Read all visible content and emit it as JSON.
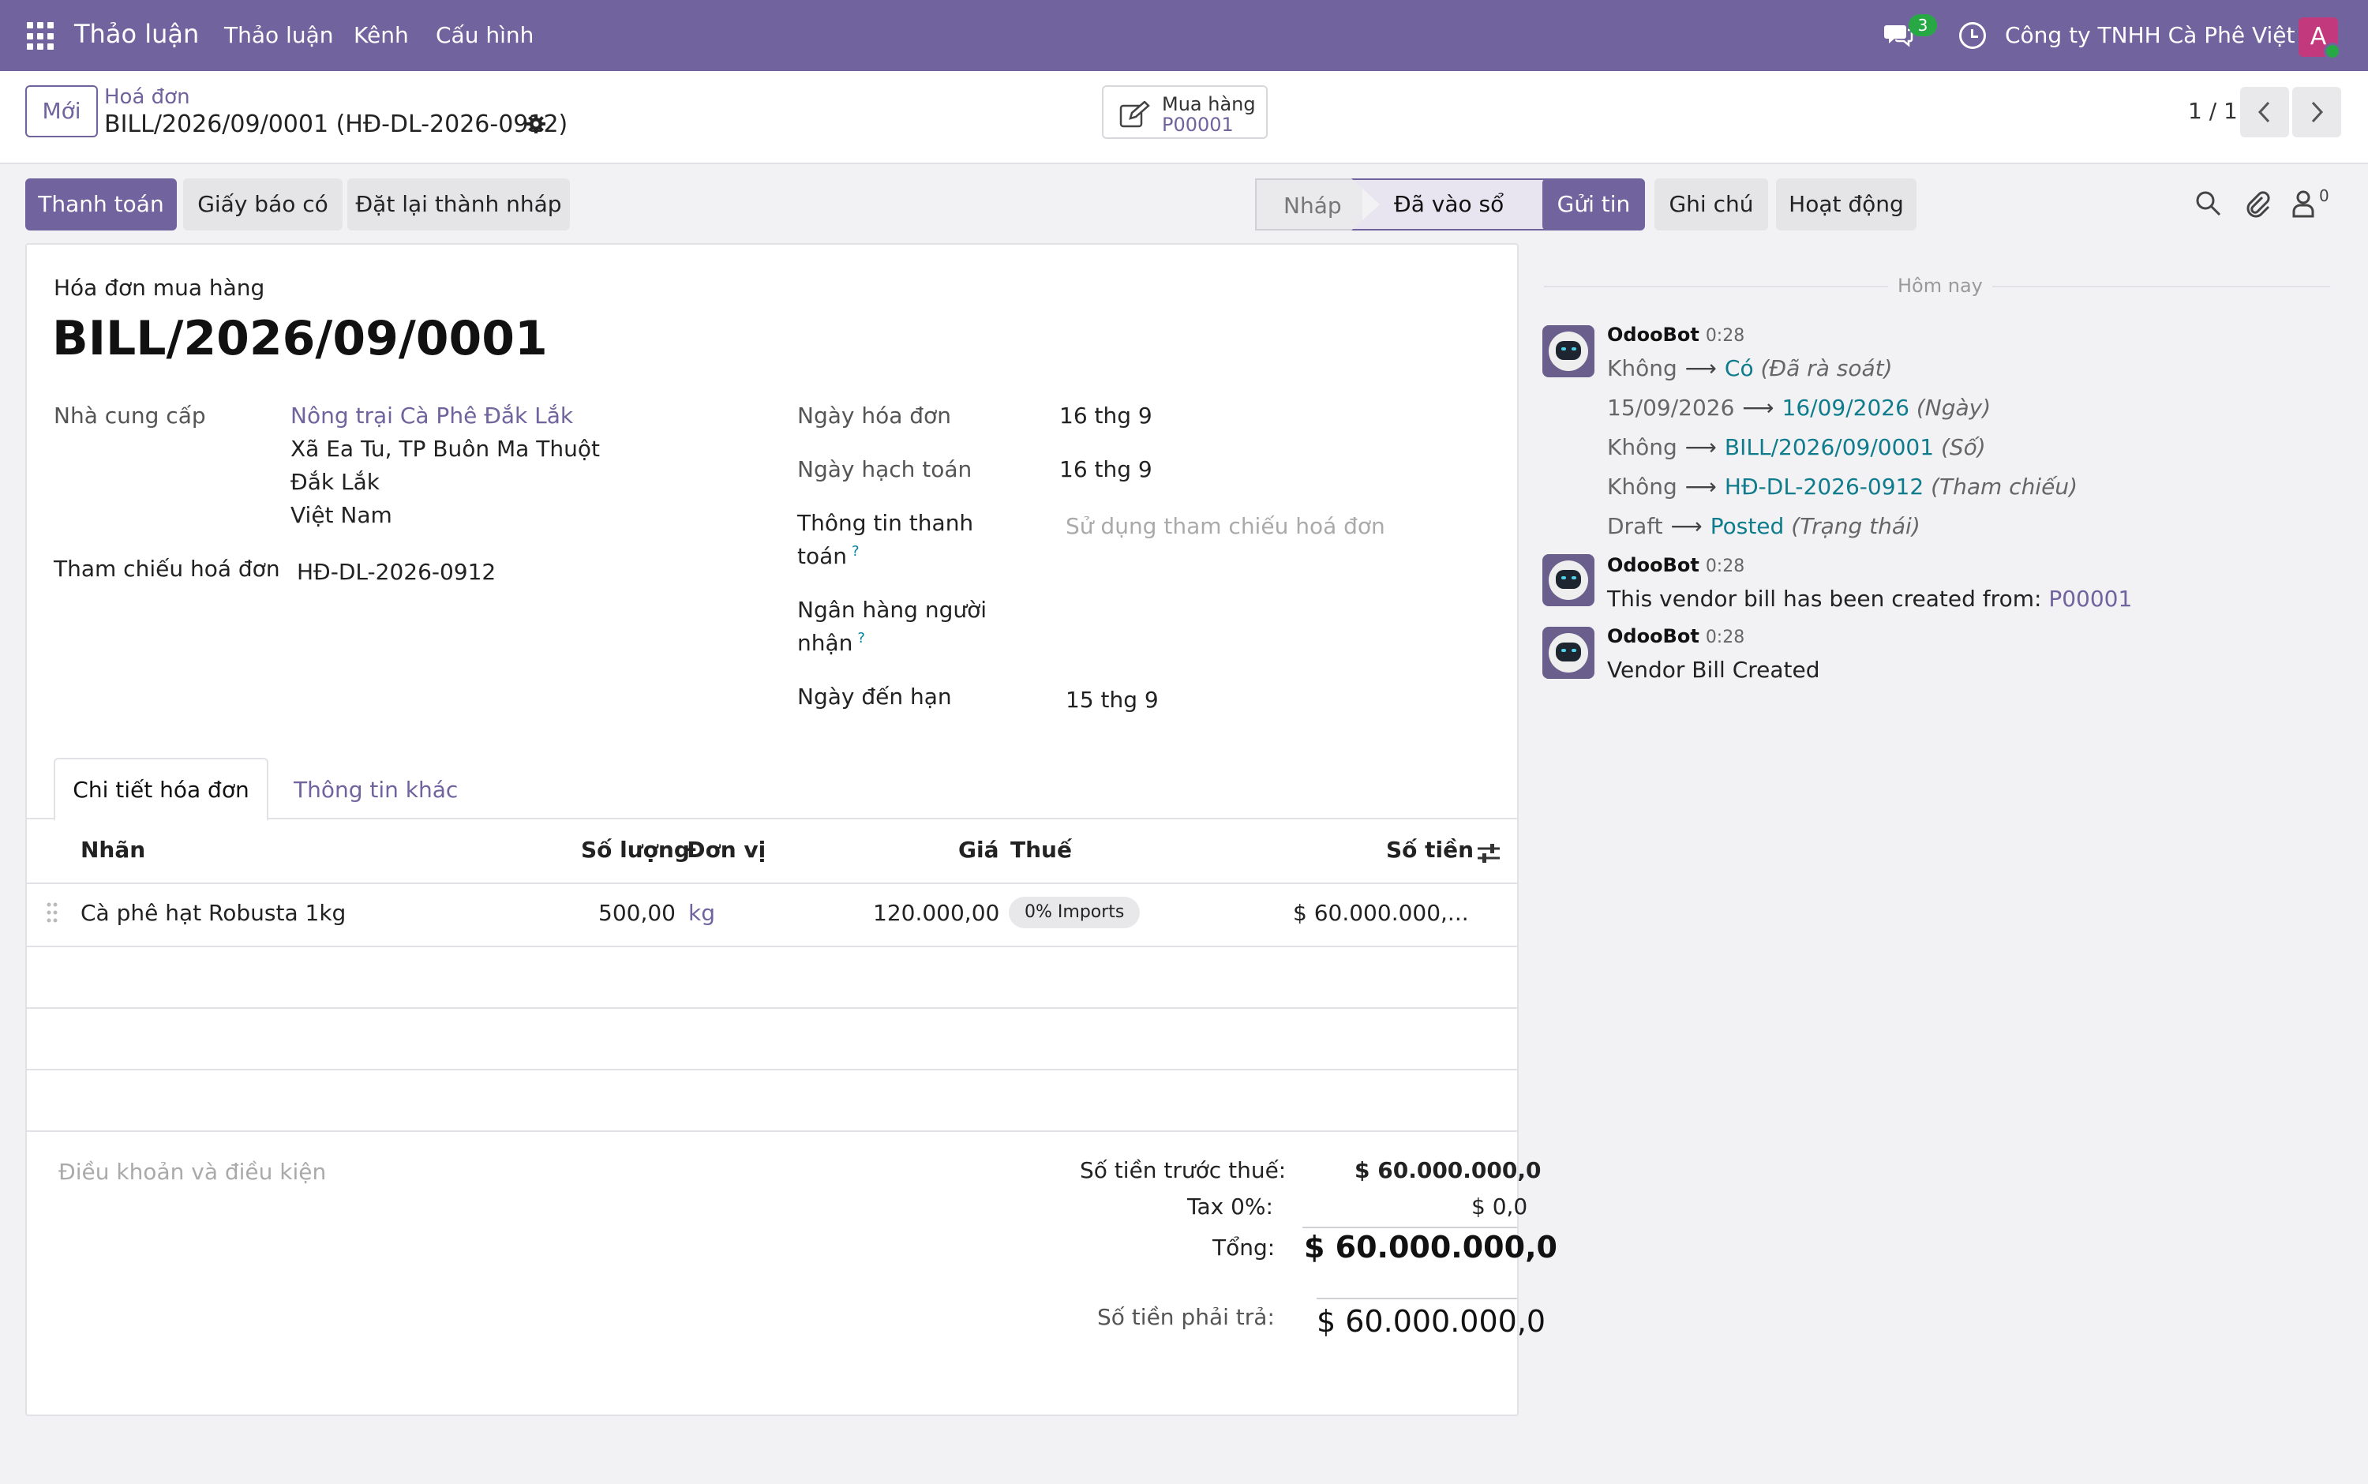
{
  "navbar": {
    "brand": "Thảo luận",
    "menu": [
      "Thảo luận",
      "Kênh",
      "Cấu hình"
    ],
    "chat_badge": "3",
    "company": "Công ty TNHH Cà Phê Việt",
    "avatar_letter": "A",
    "colors": {
      "bar": "#71639e",
      "avatar": "#c2397d",
      "online": "#28a745"
    }
  },
  "control_panel": {
    "new_button": "Mới",
    "breadcrumb_parent": "Hoá đơn",
    "breadcrumb_current": "BILL/2026/09/0001 (HĐ-DL-2026-0912)",
    "smart_button_label": "Mua hàng",
    "smart_button_value": "P00001",
    "pager": "1 / 1"
  },
  "actions": {
    "register_payment": "Thanh toán",
    "credit_note": "Giấy báo có",
    "reset_draft": "Đặt lại thành nháp"
  },
  "status": {
    "draft": "Nháp",
    "posted": "Đã vào sổ",
    "current": "posted"
  },
  "form": {
    "subtitle": "Hóa đơn mua hàng",
    "title": "BILL/2026/09/0001",
    "vendor_label": "Nhà cung cấp",
    "vendor_name": "Nông trại Cà Phê Đắk Lắk",
    "vendor_address": [
      "Xã Ea Tu, TP Buôn Ma Thuột",
      "Đắk Lắk",
      "Việt Nam"
    ],
    "ref_label": "Tham chiếu hoá đơn",
    "ref_value": "HĐ-DL-2026-0912",
    "bill_date_label": "Ngày hóa đơn",
    "bill_date": "16 thg 9",
    "accounting_date_label": "Ngày hạch toán",
    "accounting_date": "16 thg 9",
    "payment_ref_label_1": "Thông tin thanh",
    "payment_ref_label_2": "toán",
    "payment_ref_placeholder": "Sử dụng tham chiếu hoá đơn",
    "bank_label_1": "Ngân hàng người",
    "bank_label_2": "nhận",
    "help_mark": "?",
    "due_date_label": "Ngày đến hạn",
    "due_date": "15 thg 9"
  },
  "tabs": {
    "lines": "Chi tiết hóa đơn",
    "other": "Thông tin khác"
  },
  "lines_table": {
    "headers": {
      "label": "Nhãn",
      "qty": "Số lượng",
      "uom": "Đơn vị",
      "price": "Giá",
      "taxes": "Thuế",
      "subtotal": "Số tiền"
    },
    "rows": [
      {
        "label": "Cà phê hạt Robusta 1kg",
        "qty": "500,00",
        "uom": "kg",
        "price": "120.000,00",
        "tax": "0% Imports",
        "subtotal": "$ 60.000.000,..."
      }
    ]
  },
  "terms_placeholder": "Điều khoản và điều kiện",
  "totals": {
    "untaxed_label": "Số tiền trước thuế:",
    "untaxed_value": "$ 60.000.000,0",
    "tax_label": "Tax 0%:",
    "tax_value": "$ 0,0",
    "total_label": "Tổng:",
    "total_value": "$ 60.000.000,0",
    "due_label": "Số tiền phải trả:",
    "due_value": "$ 60.000.000,0"
  },
  "chatter": {
    "send_message": "Gửi tin",
    "log_note": "Ghi chú",
    "activities": "Hoạt động",
    "followers_count": "0",
    "today": "Hôm nay",
    "messages": [
      {
        "author": "OdooBot",
        "time": "0:28",
        "tracking": [
          {
            "old": "Không",
            "new": "Có",
            "field": "(Đã rà soát)"
          },
          {
            "old": "15/09/2026",
            "new": "16/09/2026",
            "field": "(Ngày)"
          },
          {
            "old": "Không",
            "new": "BILL/2026/09/0001",
            "field": "(Số)"
          },
          {
            "old": "Không",
            "new": "HĐ-DL-2026-0912",
            "field": "(Tham chiếu)"
          },
          {
            "old": "Draft",
            "new": "Posted",
            "field": "(Trạng thái)"
          }
        ]
      },
      {
        "author": "OdooBot",
        "time": "0:28",
        "body": "This vendor bill has been created from: ",
        "body_link": "P00001"
      },
      {
        "author": "OdooBot",
        "time": "0:28",
        "body": "Vendor Bill Created"
      }
    ]
  }
}
